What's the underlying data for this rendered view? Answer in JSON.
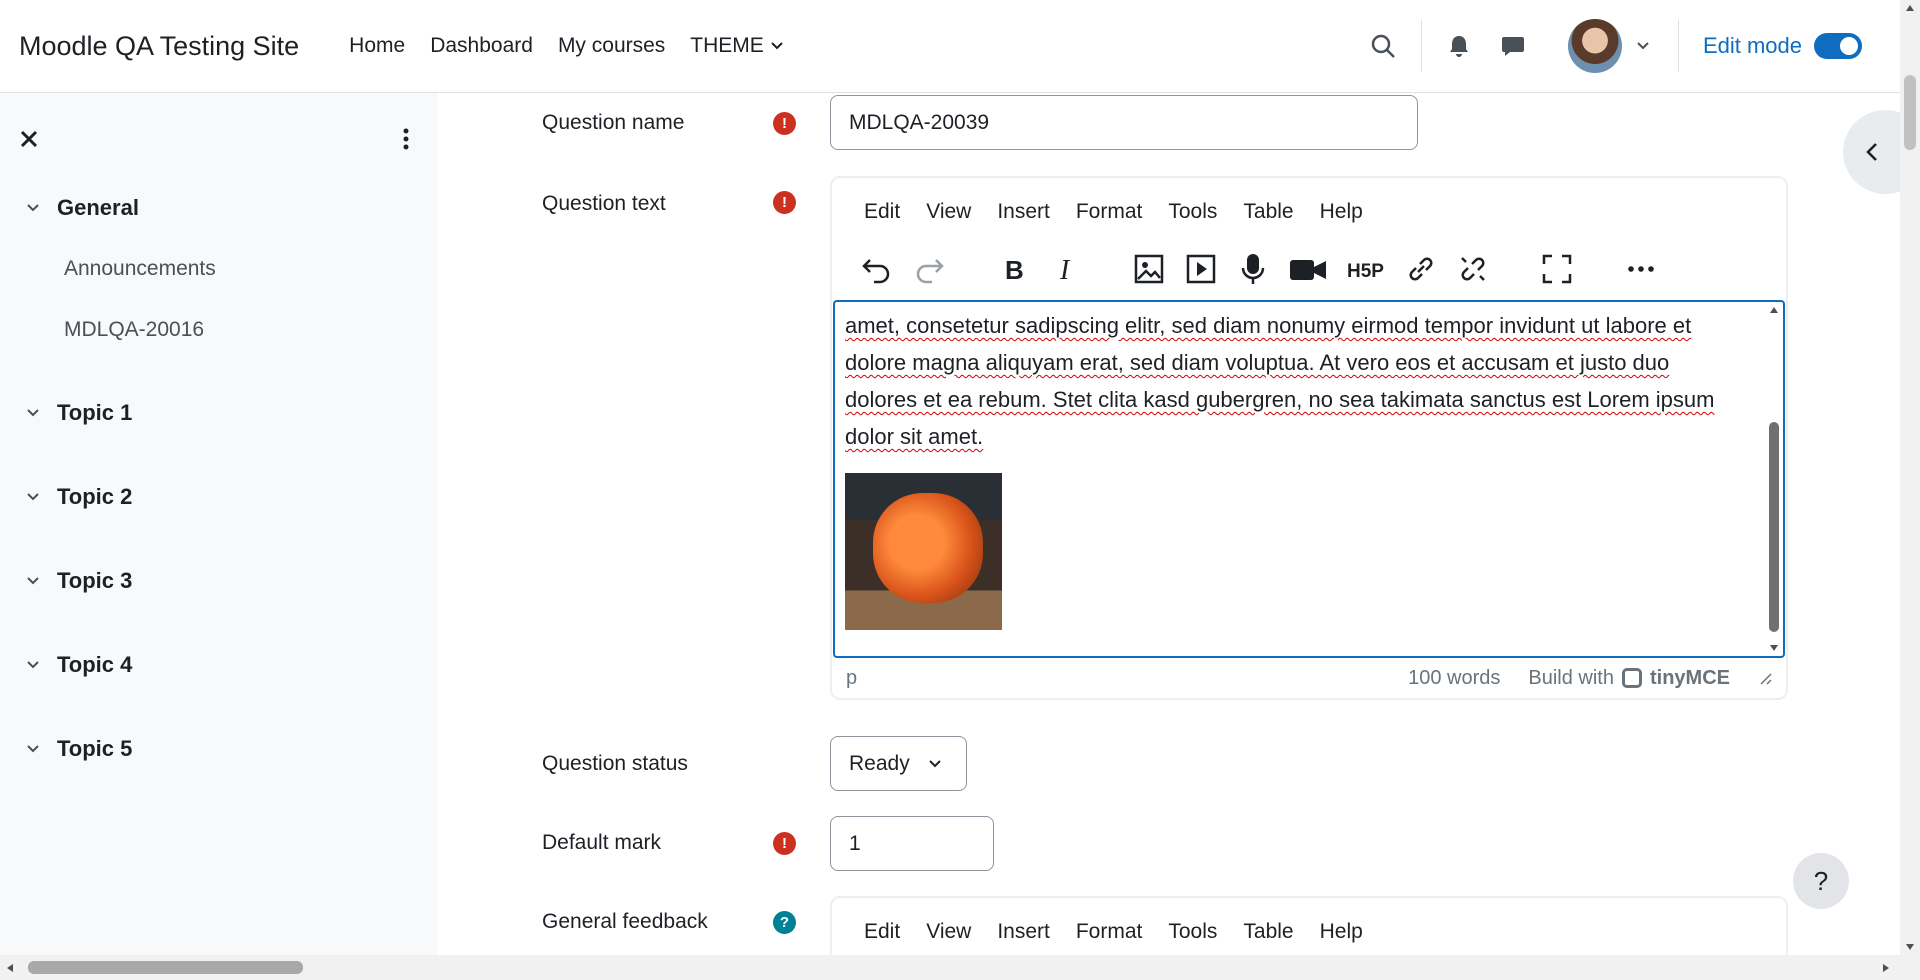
{
  "navbar": {
    "site_name": "Moodle QA Testing Site",
    "links": [
      "Home",
      "Dashboard",
      "My courses",
      "THEME"
    ],
    "edit_mode_label": "Edit mode",
    "edit_mode_on": true
  },
  "drawer": {
    "sections": [
      {
        "title": "General",
        "items": [
          "Announcements",
          "MDLQA-20016"
        ]
      },
      {
        "title": "Topic 1",
        "items": []
      },
      {
        "title": "Topic 2",
        "items": []
      },
      {
        "title": "Topic 3",
        "items": []
      },
      {
        "title": "Topic 4",
        "items": []
      },
      {
        "title": "Topic 5",
        "items": []
      }
    ]
  },
  "form": {
    "question_name_label": "Question name",
    "question_name_value": "MDLQA-20039",
    "question_text_label": "Question text",
    "question_status_label": "Question status",
    "question_status_value": "Ready",
    "default_mark_label": "Default mark",
    "default_mark_value": "1",
    "general_feedback_label": "General feedback"
  },
  "editor": {
    "menus": [
      "Edit",
      "View",
      "Insert",
      "Format",
      "Tools",
      "Table",
      "Help"
    ],
    "toolbar_icons": [
      "undo-icon",
      "redo-icon",
      "bold-icon",
      "italic-icon",
      "image-icon",
      "media-icon",
      "record-audio-icon",
      "record-video-icon",
      "h5p-icon",
      "link-icon",
      "unlink-icon",
      "fullscreen-icon",
      "more-icon"
    ],
    "content_text": "amet, consetetur sadipscing elitr, sed diam nonumy eirmod tempor invidunt ut labore et dolore magna aliquyam erat, sed diam voluptua. At vero eos et accusam et justo duo dolores et ea rebum. Stet clita kasd gubergren, no sea takimata sanctus est Lorem ipsum dolor sit amet.",
    "path": "p",
    "word_count": "100 words",
    "build_with": "Build with",
    "brand": "tinyMCE"
  },
  "help_button": "?",
  "colors": {
    "accent": "#0f6cbf",
    "required": "#ca3120",
    "info": "#008196"
  }
}
